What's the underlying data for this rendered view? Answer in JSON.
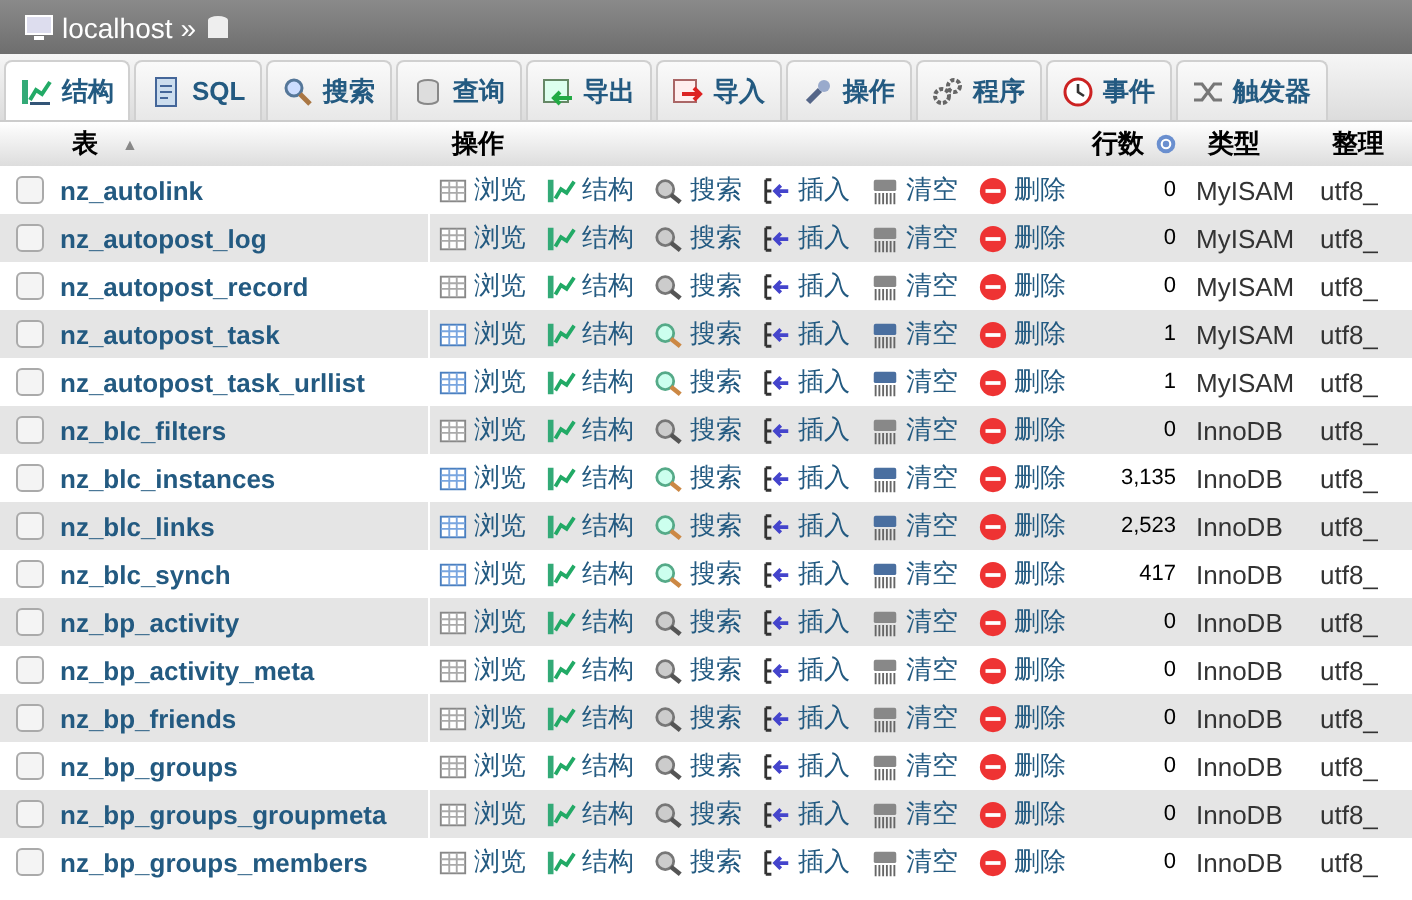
{
  "breadcrumb": {
    "server": "localhost",
    "separator": "»"
  },
  "tabs": [
    {
      "label": "结构",
      "kind": "structure",
      "selected": true
    },
    {
      "label": "SQL",
      "kind": "sql",
      "selected": false
    },
    {
      "label": "搜索",
      "kind": "search",
      "selected": false
    },
    {
      "label": "查询",
      "kind": "query",
      "selected": false
    },
    {
      "label": "导出",
      "kind": "export",
      "selected": false
    },
    {
      "label": "导入",
      "kind": "import",
      "selected": false
    },
    {
      "label": "操作",
      "kind": "operations",
      "selected": false
    },
    {
      "label": "程序",
      "kind": "routines",
      "selected": false
    },
    {
      "label": "事件",
      "kind": "events",
      "selected": false
    },
    {
      "label": "触发器",
      "kind": "triggers",
      "selected": false
    }
  ],
  "table": {
    "columns": [
      {
        "label": "表",
        "sort": "▲"
      },
      {
        "label": "操作"
      },
      {
        "label": "行数"
      },
      {
        "label": "类型"
      },
      {
        "label": "整理"
      }
    ],
    "rows": [
      {
        "name": "nz_autolink",
        "actions": [
          "浏览",
          "结构",
          "搜索",
          "插入",
          "清空",
          "删除"
        ],
        "count": "0",
        "type": "MyISAM",
        "collation": "utf8_",
        "empty": true,
        "checked": false
      },
      {
        "name": "nz_autopost_log",
        "actions": [
          "浏览",
          "结构",
          "搜索",
          "插入",
          "清空",
          "删除"
        ],
        "count": "0",
        "type": "MyISAM",
        "collation": "utf8_",
        "empty": true,
        "checked": false
      },
      {
        "name": "nz_autopost_record",
        "actions": [
          "浏览",
          "结构",
          "搜索",
          "插入",
          "清空",
          "删除"
        ],
        "count": "0",
        "type": "MyISAM",
        "collation": "utf8_",
        "empty": true,
        "checked": false
      },
      {
        "name": "nz_autopost_task",
        "actions": [
          "浏览",
          "结构",
          "搜索",
          "插入",
          "清空",
          "删除"
        ],
        "count": "1",
        "type": "MyISAM",
        "collation": "utf8_",
        "empty": false,
        "checked": false
      },
      {
        "name": "nz_autopost_task_urllist",
        "actions": [
          "浏览",
          "结构",
          "搜索",
          "插入",
          "清空",
          "删除"
        ],
        "count": "1",
        "type": "MyISAM",
        "collation": "utf8_",
        "empty": false,
        "checked": false
      },
      {
        "name": "nz_blc_filters",
        "actions": [
          "浏览",
          "结构",
          "搜索",
          "插入",
          "清空",
          "删除"
        ],
        "count": "0",
        "type": "InnoDB",
        "collation": "utf8_",
        "empty": true,
        "checked": false
      },
      {
        "name": "nz_blc_instances",
        "actions": [
          "浏览",
          "结构",
          "搜索",
          "插入",
          "清空",
          "删除"
        ],
        "count": "3,135",
        "type": "InnoDB",
        "collation": "utf8_",
        "empty": false,
        "checked": false
      },
      {
        "name": "nz_blc_links",
        "actions": [
          "浏览",
          "结构",
          "搜索",
          "插入",
          "清空",
          "删除"
        ],
        "count": "2,523",
        "type": "InnoDB",
        "collation": "utf8_",
        "empty": false,
        "checked": false
      },
      {
        "name": "nz_blc_synch",
        "actions": [
          "浏览",
          "结构",
          "搜索",
          "插入",
          "清空",
          "删除"
        ],
        "count": "417",
        "type": "InnoDB",
        "collation": "utf8_",
        "empty": false,
        "checked": false
      },
      {
        "name": "nz_bp_activity",
        "actions": [
          "浏览",
          "结构",
          "搜索",
          "插入",
          "清空",
          "删除"
        ],
        "count": "0",
        "type": "InnoDB",
        "collation": "utf8_",
        "empty": true,
        "checked": false
      },
      {
        "name": "nz_bp_activity_meta",
        "actions": [
          "浏览",
          "结构",
          "搜索",
          "插入",
          "清空",
          "删除"
        ],
        "count": "0",
        "type": "InnoDB",
        "collation": "utf8_",
        "empty": true,
        "checked": false
      },
      {
        "name": "nz_bp_friends",
        "actions": [
          "浏览",
          "结构",
          "搜索",
          "插入",
          "清空",
          "删除"
        ],
        "count": "0",
        "type": "InnoDB",
        "collation": "utf8_",
        "empty": true,
        "checked": false
      },
      {
        "name": "nz_bp_groups",
        "actions": [
          "浏览",
          "结构",
          "搜索",
          "插入",
          "清空",
          "删除"
        ],
        "count": "0",
        "type": "InnoDB",
        "collation": "utf8_",
        "empty": true,
        "checked": false
      },
      {
        "name": "nz_bp_groups_groupmeta",
        "actions": [
          "浏览",
          "结构",
          "搜索",
          "插入",
          "清空",
          "删除"
        ],
        "count": "0",
        "type": "InnoDB",
        "collation": "utf8_",
        "empty": true,
        "checked": false
      },
      {
        "name": "nz_bp_groups_members",
        "actions": [
          "浏览",
          "结构",
          "搜索",
          "插入",
          "清空",
          "删除"
        ],
        "count": "0",
        "type": "InnoDB",
        "collation": "utf8_",
        "empty": true,
        "checked": false
      }
    ]
  }
}
